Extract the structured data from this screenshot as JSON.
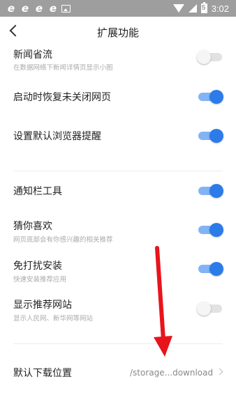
{
  "status_bar": {
    "notification_icons": [
      "e",
      "e",
      "e",
      "e"
    ],
    "time": "3:02",
    "battery_level": "5"
  },
  "header": {
    "title": "扩展功能"
  },
  "settings": [
    {
      "label": "新闻省流",
      "subtitle": "在数据网络下新闻详情页显示小图",
      "enabled": false
    },
    {
      "label": "启动时恢复未关闭网页",
      "subtitle": "",
      "enabled": true
    },
    {
      "label": "设置默认浏览器提醒",
      "subtitle": "",
      "enabled": true
    },
    {
      "label": "通知栏工具",
      "subtitle": "",
      "enabled": true
    },
    {
      "label": "猜你喜欢",
      "subtitle": "网页底部会有你感兴趣的相关推荐",
      "enabled": true
    },
    {
      "label": "免打扰安装",
      "subtitle": "快速安装推荐应用",
      "enabled": true
    },
    {
      "label": "显示推荐网站",
      "subtitle": "显示人民网、新华网等网站",
      "enabled": false
    }
  ],
  "download": {
    "label": "默认下载位置",
    "value": "/storage...download"
  },
  "colors": {
    "toggle_on_knob": "#2b7be8",
    "toggle_on_track": "#82b4f5",
    "annotation_arrow": "#e8141b"
  }
}
